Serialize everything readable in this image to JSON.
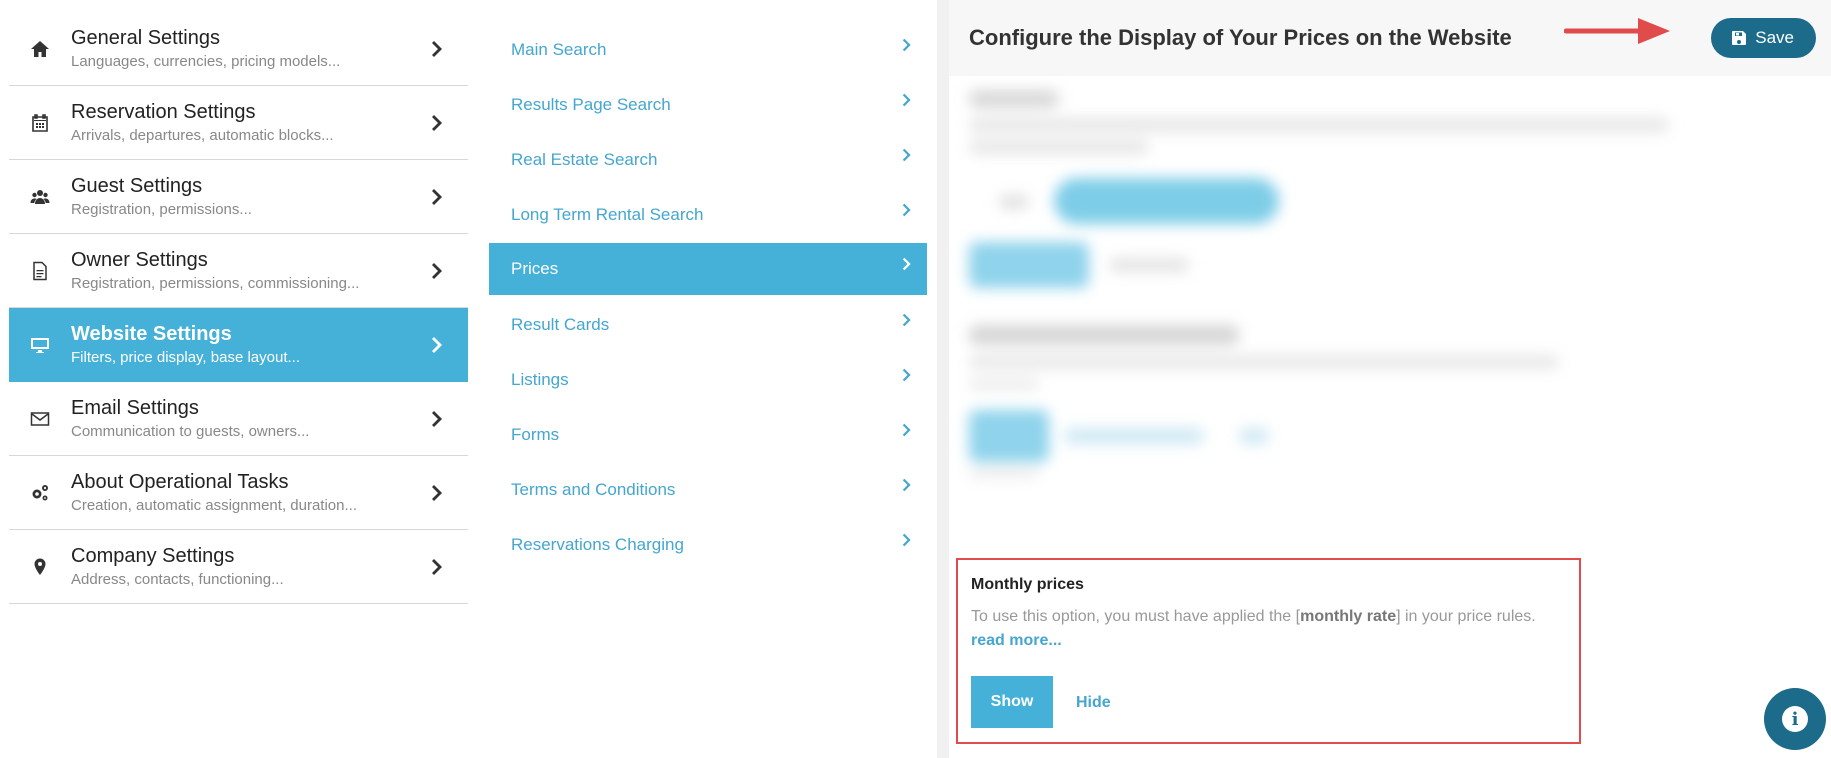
{
  "left_menu": [
    {
      "icon": "home-icon",
      "title": "General Settings",
      "subtitle": "Languages, currencies, pricing models...",
      "active": false
    },
    {
      "icon": "calendar-icon",
      "title": "Reservation Settings",
      "subtitle": "Arrivals, departures, automatic blocks...",
      "active": false
    },
    {
      "icon": "users-icon",
      "title": "Guest Settings",
      "subtitle": "Registration, permissions...",
      "active": false
    },
    {
      "icon": "document-icon",
      "title": "Owner Settings",
      "subtitle": "Registration, permissions, commissioning...",
      "active": false
    },
    {
      "icon": "monitor-icon",
      "title": "Website Settings",
      "subtitle": "Filters, price display, base layout...",
      "active": true
    },
    {
      "icon": "envelope-icon",
      "title": "Email Settings",
      "subtitle": "Communication to guests, owners...",
      "active": false
    },
    {
      "icon": "gears-icon",
      "title": "About Operational Tasks",
      "subtitle": "Creation, automatic assignment, duration...",
      "active": false
    },
    {
      "icon": "map-pin-icon",
      "title": "Company Settings",
      "subtitle": "Address, contacts, functioning...",
      "active": false
    }
  ],
  "sub_menu": [
    {
      "label": "Main Search",
      "active": false
    },
    {
      "label": "Results Page Search",
      "active": false
    },
    {
      "label": "Real Estate Search",
      "active": false
    },
    {
      "label": "Long Term Rental Search",
      "active": false
    },
    {
      "label": "Prices",
      "active": true
    },
    {
      "label": "Result Cards",
      "active": false
    },
    {
      "label": "Listings",
      "active": false
    },
    {
      "label": "Forms",
      "active": false
    },
    {
      "label": "Terms and Conditions",
      "active": false
    },
    {
      "label": "Reservations Charging",
      "active": false
    }
  ],
  "panel": {
    "title": "Configure the Display of Your Prices on the Website",
    "save_label": "Save"
  },
  "monthly_prices": {
    "title": "Monthly prices",
    "desc_before": "To use this option, you must have applied the [",
    "desc_bold": "monthly rate",
    "desc_after": "] in your price rules.",
    "read_more": "read more...",
    "show_label": "Show",
    "hide_label": "Hide"
  },
  "info_button": {
    "glyph": "i"
  },
  "colors": {
    "accent": "#45b1d9",
    "link": "#45a6cf",
    "primary_dark": "#1c6b8a",
    "highlight_red": "#e04b4b"
  }
}
